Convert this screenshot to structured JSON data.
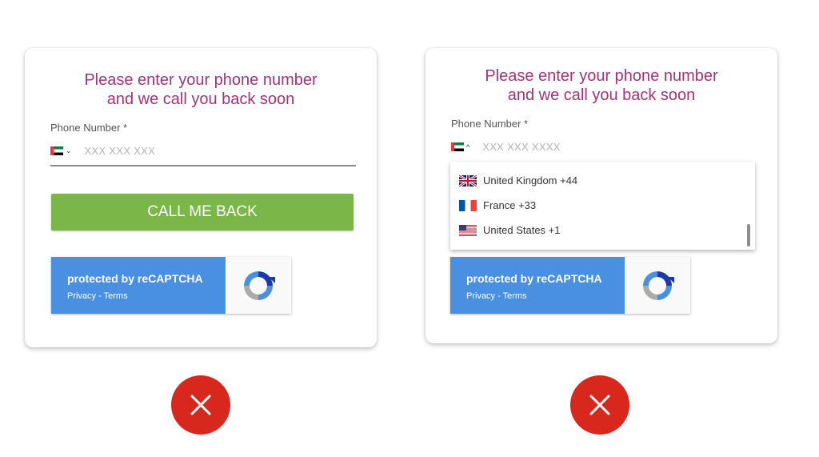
{
  "left_card": {
    "heading_line1": "Please enter your phone number",
    "heading_line2": "and we call you back soon",
    "phone_label": "Phone Number *",
    "phone_placeholder": "XXX XXX XXX",
    "country_flag": "flag-ae",
    "dropdown_indicator": "chevron-down-icon",
    "cta_label": "CALL ME BACK",
    "recaptcha": {
      "title": "protected by reCAPTCHA",
      "links": "Privacy - Terms",
      "logo_icon": "recaptcha-logo-icon"
    }
  },
  "right_card": {
    "heading_line1": "Please enter your phone number",
    "heading_line2": "and we call you back soon",
    "phone_label": "Phone Number *",
    "phone_placeholder": "XXX XXX XXXX",
    "country_flag": "flag-ae",
    "dropdown_indicator": "chevron-up-icon",
    "dropdown_items": [
      {
        "label": "United Kingdom +44",
        "flag": "flag-uk"
      },
      {
        "label": "France +33",
        "flag": "flag-fr"
      },
      {
        "label": "United States +1",
        "flag": "flag-us"
      }
    ],
    "recaptcha": {
      "title": "protected by reCAPTCHA",
      "links": "Privacy - Terms",
      "logo_icon": "recaptcha-logo-icon"
    }
  },
  "status_icons": [
    "close-icon",
    "close-icon"
  ],
  "colors": {
    "heading": "#a23478",
    "cta": "#7ab648",
    "recaptcha": "#4a90e2",
    "error": "#d8271c"
  }
}
